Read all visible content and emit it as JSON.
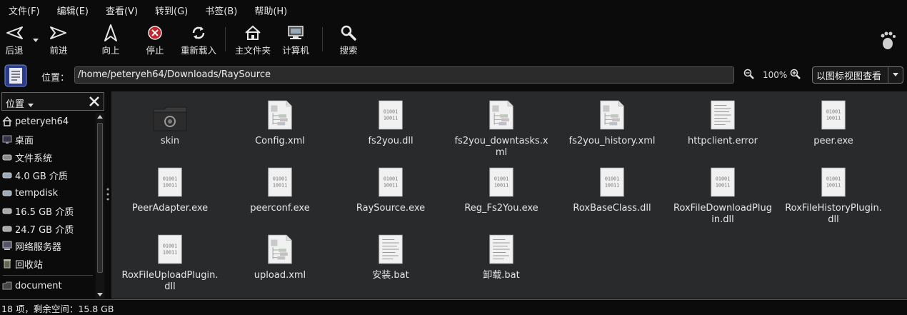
{
  "menubar": {
    "items": [
      {
        "name": "menu-file",
        "label": "文件(F)"
      },
      {
        "name": "menu-edit",
        "label": "编辑(E)"
      },
      {
        "name": "menu-view",
        "label": "查看(V)"
      },
      {
        "name": "menu-go",
        "label": "转到(G)"
      },
      {
        "name": "menu-bookmarks",
        "label": "书签(B)"
      },
      {
        "name": "menu-help",
        "label": "帮助(H)"
      }
    ]
  },
  "toolbar": {
    "back": "后退",
    "forward": "前进",
    "up": "向上",
    "stop": "停止",
    "reload": "重新载入",
    "home": "主文件夹",
    "computer": "计算机",
    "search": "搜索"
  },
  "location": {
    "label": "位置：",
    "path": "/home/peteryeh64/Downloads/RaySource",
    "zoom": "100%",
    "view_mode": "以图标视图查看"
  },
  "sidebar": {
    "header": "位置",
    "items": [
      {
        "label": "peteryeh64",
        "icon": "home-icon"
      },
      {
        "label": "桌面",
        "icon": "desktop-icon"
      },
      {
        "label": "文件系统",
        "icon": "filesystem-icon"
      },
      {
        "label": "4.0 GB 介质",
        "icon": "drive-icon"
      },
      {
        "label": "tempdisk",
        "icon": "drive-icon"
      },
      {
        "label": "16.5 GB 介质",
        "icon": "drive-icon"
      },
      {
        "label": "24.7 GB 介质",
        "icon": "drive-icon"
      },
      {
        "label": "网络服务器",
        "icon": "network-icon"
      },
      {
        "label": "回收站",
        "icon": "trash-icon"
      },
      {
        "label": "document",
        "icon": "folder-icon"
      }
    ]
  },
  "files": [
    {
      "name": "skin",
      "type": "folder"
    },
    {
      "name": "Config.xml",
      "type": "xml"
    },
    {
      "name": "fs2you.dll",
      "type": "binary"
    },
    {
      "name": "fs2you_downtasks.xml",
      "type": "xml"
    },
    {
      "name": "fs2you_history.xml",
      "type": "xml"
    },
    {
      "name": "httpclient.error",
      "type": "text"
    },
    {
      "name": "peer.exe",
      "type": "binary"
    },
    {
      "name": "PeerAdapter.exe",
      "type": "binary"
    },
    {
      "name": "peerconf.exe",
      "type": "binary"
    },
    {
      "name": "RaySource.exe",
      "type": "binary"
    },
    {
      "name": "Reg_Fs2You.exe",
      "type": "binary"
    },
    {
      "name": "RoxBaseClass.dll",
      "type": "binary"
    },
    {
      "name": "RoxFileDownloadPlugin.dll",
      "type": "binary"
    },
    {
      "name": "RoxFileHistoryPlugin.dll",
      "type": "binary"
    },
    {
      "name": "RoxFileUploadPlugin.dll",
      "type": "binary"
    },
    {
      "name": "upload.xml",
      "type": "xml"
    },
    {
      "name": "安装.bat",
      "type": "text"
    },
    {
      "name": "卸载.bat",
      "type": "text"
    }
  ],
  "status": {
    "text": "18 项，剩余空间：15.8 GB"
  },
  "colors": {
    "background": "#0b0b0b",
    "content": "#292a2c",
    "stop_red": "#c0262a"
  }
}
